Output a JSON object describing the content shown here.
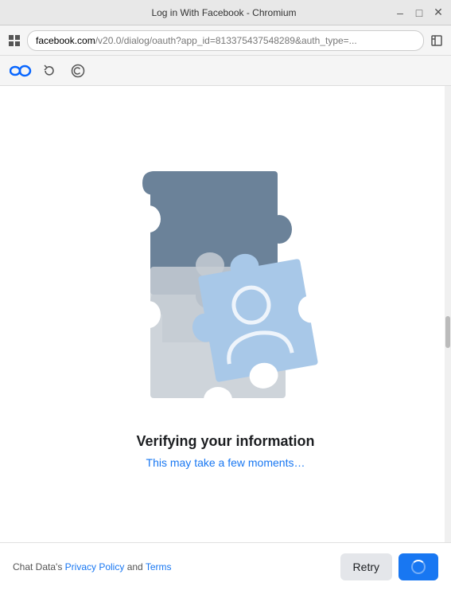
{
  "window": {
    "title": "Log in With Facebook - Chromium",
    "minimize_label": "minimize",
    "maximize_label": "maximize",
    "close_label": "close"
  },
  "address_bar": {
    "domain": "facebook.com",
    "path": "/v20.0/dialog/oauth?app_id=813375437548289&auth_type=..."
  },
  "toolbar": {
    "meta_icon": "⊕",
    "refresh_icon": "↺",
    "copyright_icon": "©"
  },
  "main": {
    "verify_title": "Verifying your information",
    "verify_subtitle": "This may take a few moments…"
  },
  "footer": {
    "prefix_text": "Chat Data's ",
    "privacy_policy_label": "Privacy Policy",
    "and_text": " and ",
    "terms_label": "Terms",
    "retry_label": "Retry"
  }
}
